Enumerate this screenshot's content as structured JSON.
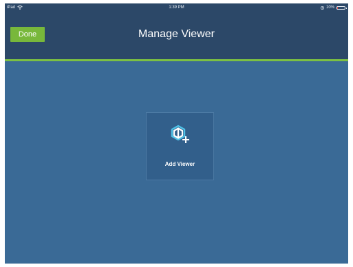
{
  "statusbar": {
    "carrier": "iPad",
    "time": "1:39 PM",
    "battery": "10%",
    "battery_level": 0.1
  },
  "navbar": {
    "done_label": "Done",
    "title": "Manage Viewer"
  },
  "main": {
    "tile_label": "Add Viewer",
    "tile_icon": "add-viewer-icon"
  },
  "colors": {
    "navbar_bg": "#2c4868",
    "content_bg": "#3a6a96",
    "accent_green": "#78b83b",
    "divider_green": "#7cc043",
    "tile_bg": "#325f8b"
  }
}
